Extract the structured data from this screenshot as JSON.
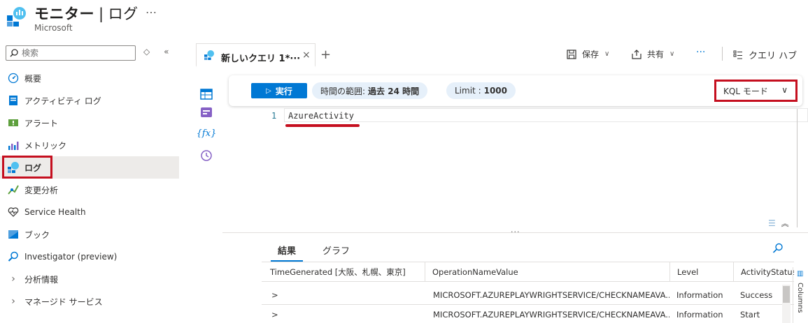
{
  "header": {
    "title": "モニター",
    "separator": "|",
    "section": "ログ",
    "more": "…",
    "subtitle": "Microsoft"
  },
  "sidebar": {
    "search_placeholder": "検索",
    "collapse": "«",
    "sort": "◇",
    "items": [
      {
        "label": "概要",
        "icon": "overview-icon"
      },
      {
        "label": "アクティビティ ログ",
        "icon": "activity-log-icon"
      },
      {
        "label": "アラート",
        "icon": "alert-icon"
      },
      {
        "label": "メトリック",
        "icon": "metrics-icon"
      },
      {
        "label": "ログ",
        "icon": "logs-icon",
        "active": true
      },
      {
        "label": "変更分析",
        "icon": "change-analysis-icon"
      },
      {
        "label": "Service Health",
        "icon": "service-health-icon"
      },
      {
        "label": "ブック",
        "icon": "workbook-icon"
      },
      {
        "label": "Investigator (preview)",
        "icon": "search-icon"
      },
      {
        "label": "分析情報",
        "icon": "chevron-right-icon"
      },
      {
        "label": "マネージド サービス",
        "icon": "chevron-right-icon"
      }
    ]
  },
  "tabs": {
    "active_label": "新しいクエリ 1*",
    "dots": "···",
    "close": "×",
    "add": "+"
  },
  "commands": {
    "save": "保存",
    "share": "共有",
    "more": "···",
    "query_hub": "クエリ ハブ"
  },
  "toolbar": {
    "run": "実行",
    "time_range_label": "時間の範囲:",
    "time_range_value": "過去 24 時間",
    "limit_label": "Limit :",
    "limit_value": "1000",
    "mode": "KQL モード"
  },
  "editor": {
    "line_number": "1",
    "code": "AzureActivity"
  },
  "results": {
    "tab_results": "結果",
    "tab_chart": "グラフ",
    "columns_label": "Columns",
    "headers": [
      "TimeGenerated [大阪、札幌、東京]",
      "OperationNameValue",
      "Level",
      "ActivityStatus"
    ],
    "rows": [
      {
        "expand": ">",
        "time": "",
        "operation": "MICROSOFT.AZUREPLAYWRIGHTSERVICE/CHECKNAMEAVA...",
        "level": "Information",
        "status": "Success"
      },
      {
        "expand": ">",
        "time": "",
        "operation": "MICROSOFT.AZUREPLAYWRIGHTSERVICE/CHECKNAMEAVA...",
        "level": "Information",
        "status": "Start"
      }
    ]
  },
  "colors": {
    "accent": "#0078d4",
    "highlight": "#c50f1f",
    "pill_bg": "#e6f0fa"
  }
}
